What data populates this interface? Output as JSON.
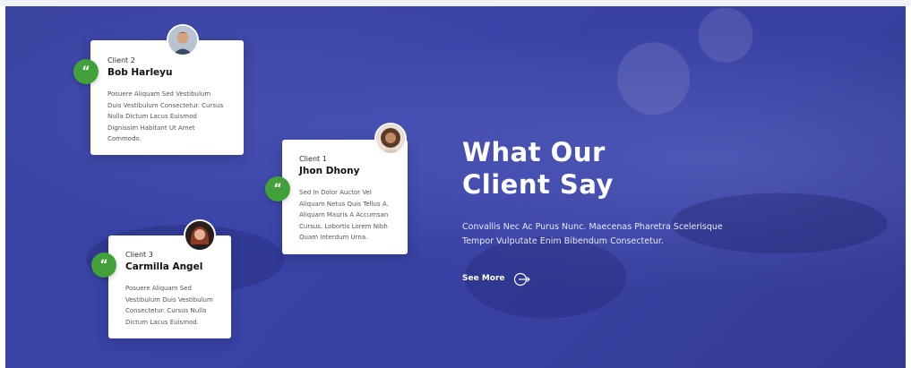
{
  "section": {
    "headline_line1": "What Our",
    "headline_line2": "Client Say",
    "description_line1": "Convallis Nec Ac Purus Nunc. Maecenas Pharetra Scelerisque",
    "description_line2": "Tempor Vulputate Enim Bibendum Consectetur.",
    "see_more_label": "See More"
  },
  "testimonials": [
    {
      "tag": "Client 2",
      "name": "Bob Harleyu",
      "lines": [
        "Posuere Aliquam Sed Vestibulum",
        "Duis Vestibulum Consectetur. Cursus",
        "Nulla Dictum Lacus Euismod",
        "Dignissim Habitant Ut Amet",
        "Commodo."
      ]
    },
    {
      "tag": "Client 1",
      "name": "Jhon Dhony",
      "lines": [
        "Sed In Dolor Auctor Vel",
        "Aliquam Netus Quis Tellus A.",
        "Aliquam Mauris A Accumsan",
        "Cursus. Lobortis Lorem Nibh",
        "Quam Interdum Urna."
      ]
    },
    {
      "tag": "Client 3",
      "name": "Carmilla Angel",
      "lines": [
        "Posuere Aliquam Sed",
        "Vestibulum Duis Vestibulum",
        "Consectetur. Cursus Nulla",
        "Dictum Lacus Euismod."
      ]
    }
  ],
  "icons": {
    "quote": "“",
    "quote_icon": "quote-icon",
    "arrow_icon": "arrow-circle-right-icon"
  },
  "colors": {
    "overlay": "#3943a6",
    "accent_green": "#43a13b",
    "card_bg": "#ffffff"
  }
}
